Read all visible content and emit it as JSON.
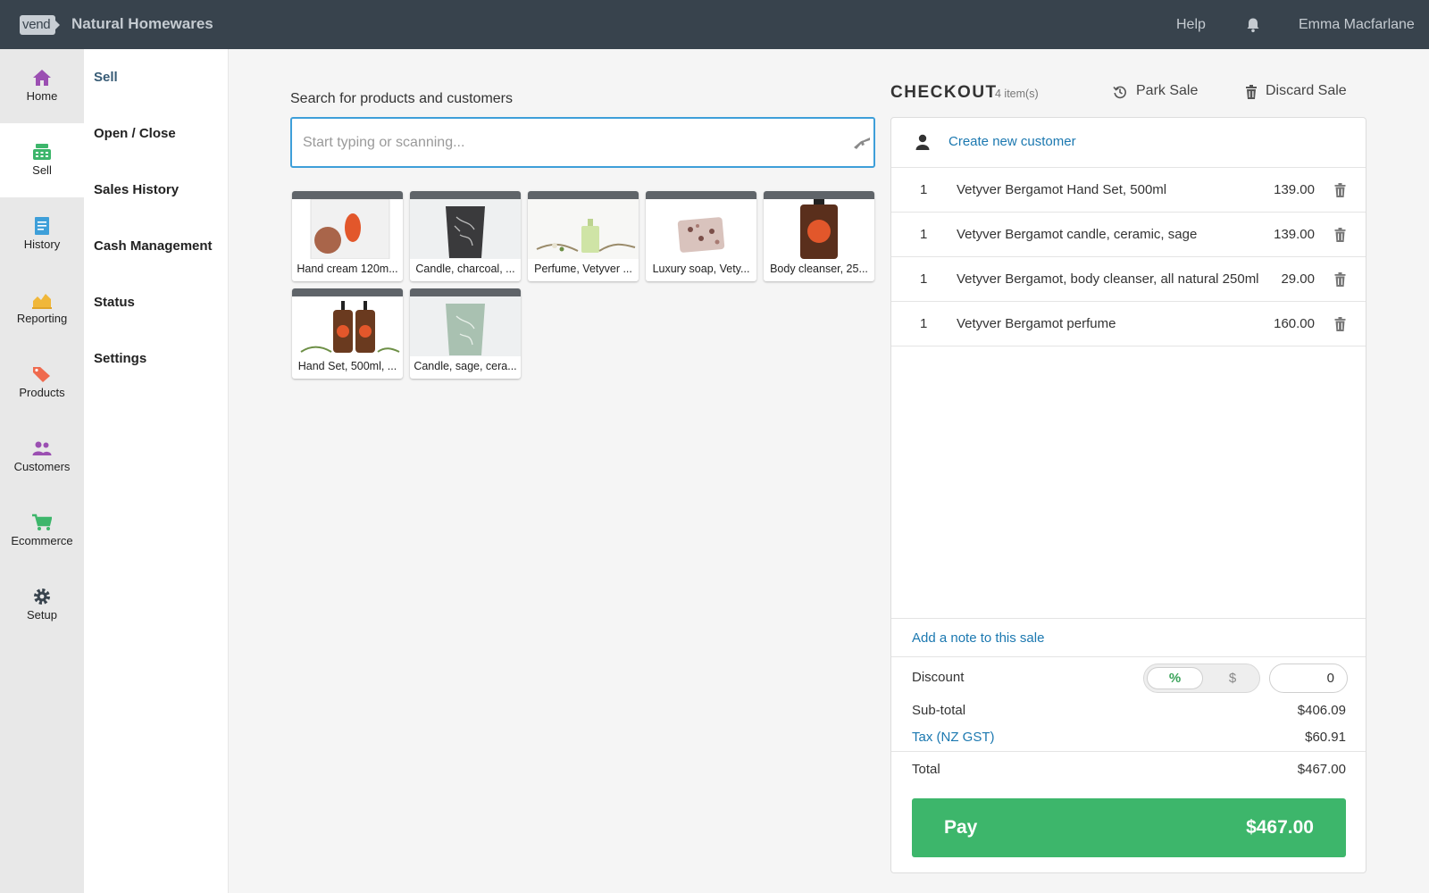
{
  "topbar": {
    "logo": "vend",
    "store_name": "Natural Homewares",
    "help": "Help",
    "user": "Emma Macfarlane"
  },
  "rail": {
    "items": [
      {
        "label": "Home",
        "icon": "home-icon",
        "color": "#9b4fb2"
      },
      {
        "label": "Sell",
        "icon": "register-icon",
        "color": "#3db66b",
        "active": true
      },
      {
        "label": "History",
        "icon": "document-icon",
        "color": "#3e9fd9"
      },
      {
        "label": "Reporting",
        "icon": "chart-icon",
        "color": "#f0b73a"
      },
      {
        "label": "Products",
        "icon": "tags-icon",
        "color": "#ef6a4e"
      },
      {
        "label": "Customers",
        "icon": "users-icon",
        "color": "#9b4fb2"
      },
      {
        "label": "Ecommerce",
        "icon": "cart-icon",
        "color": "#3db66b"
      },
      {
        "label": "Setup",
        "icon": "gear-icon",
        "color": "#38434d"
      }
    ]
  },
  "subnav": {
    "items": [
      {
        "label": "Sell",
        "active": true
      },
      {
        "label": "Open / Close"
      },
      {
        "label": "Sales History"
      },
      {
        "label": "Cash Management"
      },
      {
        "label": "Status"
      },
      {
        "label": "Settings"
      }
    ]
  },
  "search": {
    "label": "Search for products and customers",
    "placeholder": "Start typing or scanning..."
  },
  "products": [
    {
      "label": "Hand cream 120m..."
    },
    {
      "label": "Candle, charcoal, ..."
    },
    {
      "label": "Perfume, Vetyver ..."
    },
    {
      "label": "Luxury soap, Vety..."
    },
    {
      "label": "Body cleanser, 25..."
    },
    {
      "label": "Hand Set, 500ml, ..."
    },
    {
      "label": "Candle, sage, cera..."
    }
  ],
  "checkout": {
    "title": "CHECKOUT",
    "count": "4 item(s)",
    "park": "Park Sale",
    "discard": "Discard Sale",
    "create_customer": "Create new customer",
    "lines": [
      {
        "qty": "1",
        "name": "Vetyver Bergamot Hand Set, 500ml",
        "price": "139.00"
      },
      {
        "qty": "1",
        "name": "Vetyver Bergamot candle, ceramic, sage",
        "price": "139.00"
      },
      {
        "qty": "1",
        "name": "Vetyver Bergamot, body cleanser, all natural 250ml",
        "price": "29.00"
      },
      {
        "qty": "1",
        "name": "Vetyver Bergamot perfume",
        "price": "160.00"
      }
    ],
    "add_note": "Add a note to this sale",
    "discount_label": "Discount",
    "discount_pct": "%",
    "discount_dollar": "$",
    "discount_value": "0",
    "subtotal_label": "Sub-total",
    "subtotal": "$406.09",
    "tax_label": "Tax (NZ GST)",
    "tax": "$60.91",
    "total_label": "Total",
    "total": "$467.00",
    "pay_label": "Pay",
    "pay_amount": "$467.00"
  },
  "colors": {
    "topbar": "#38434d",
    "accent_blue": "#1b78b0",
    "pay_green": "#3db66b"
  }
}
